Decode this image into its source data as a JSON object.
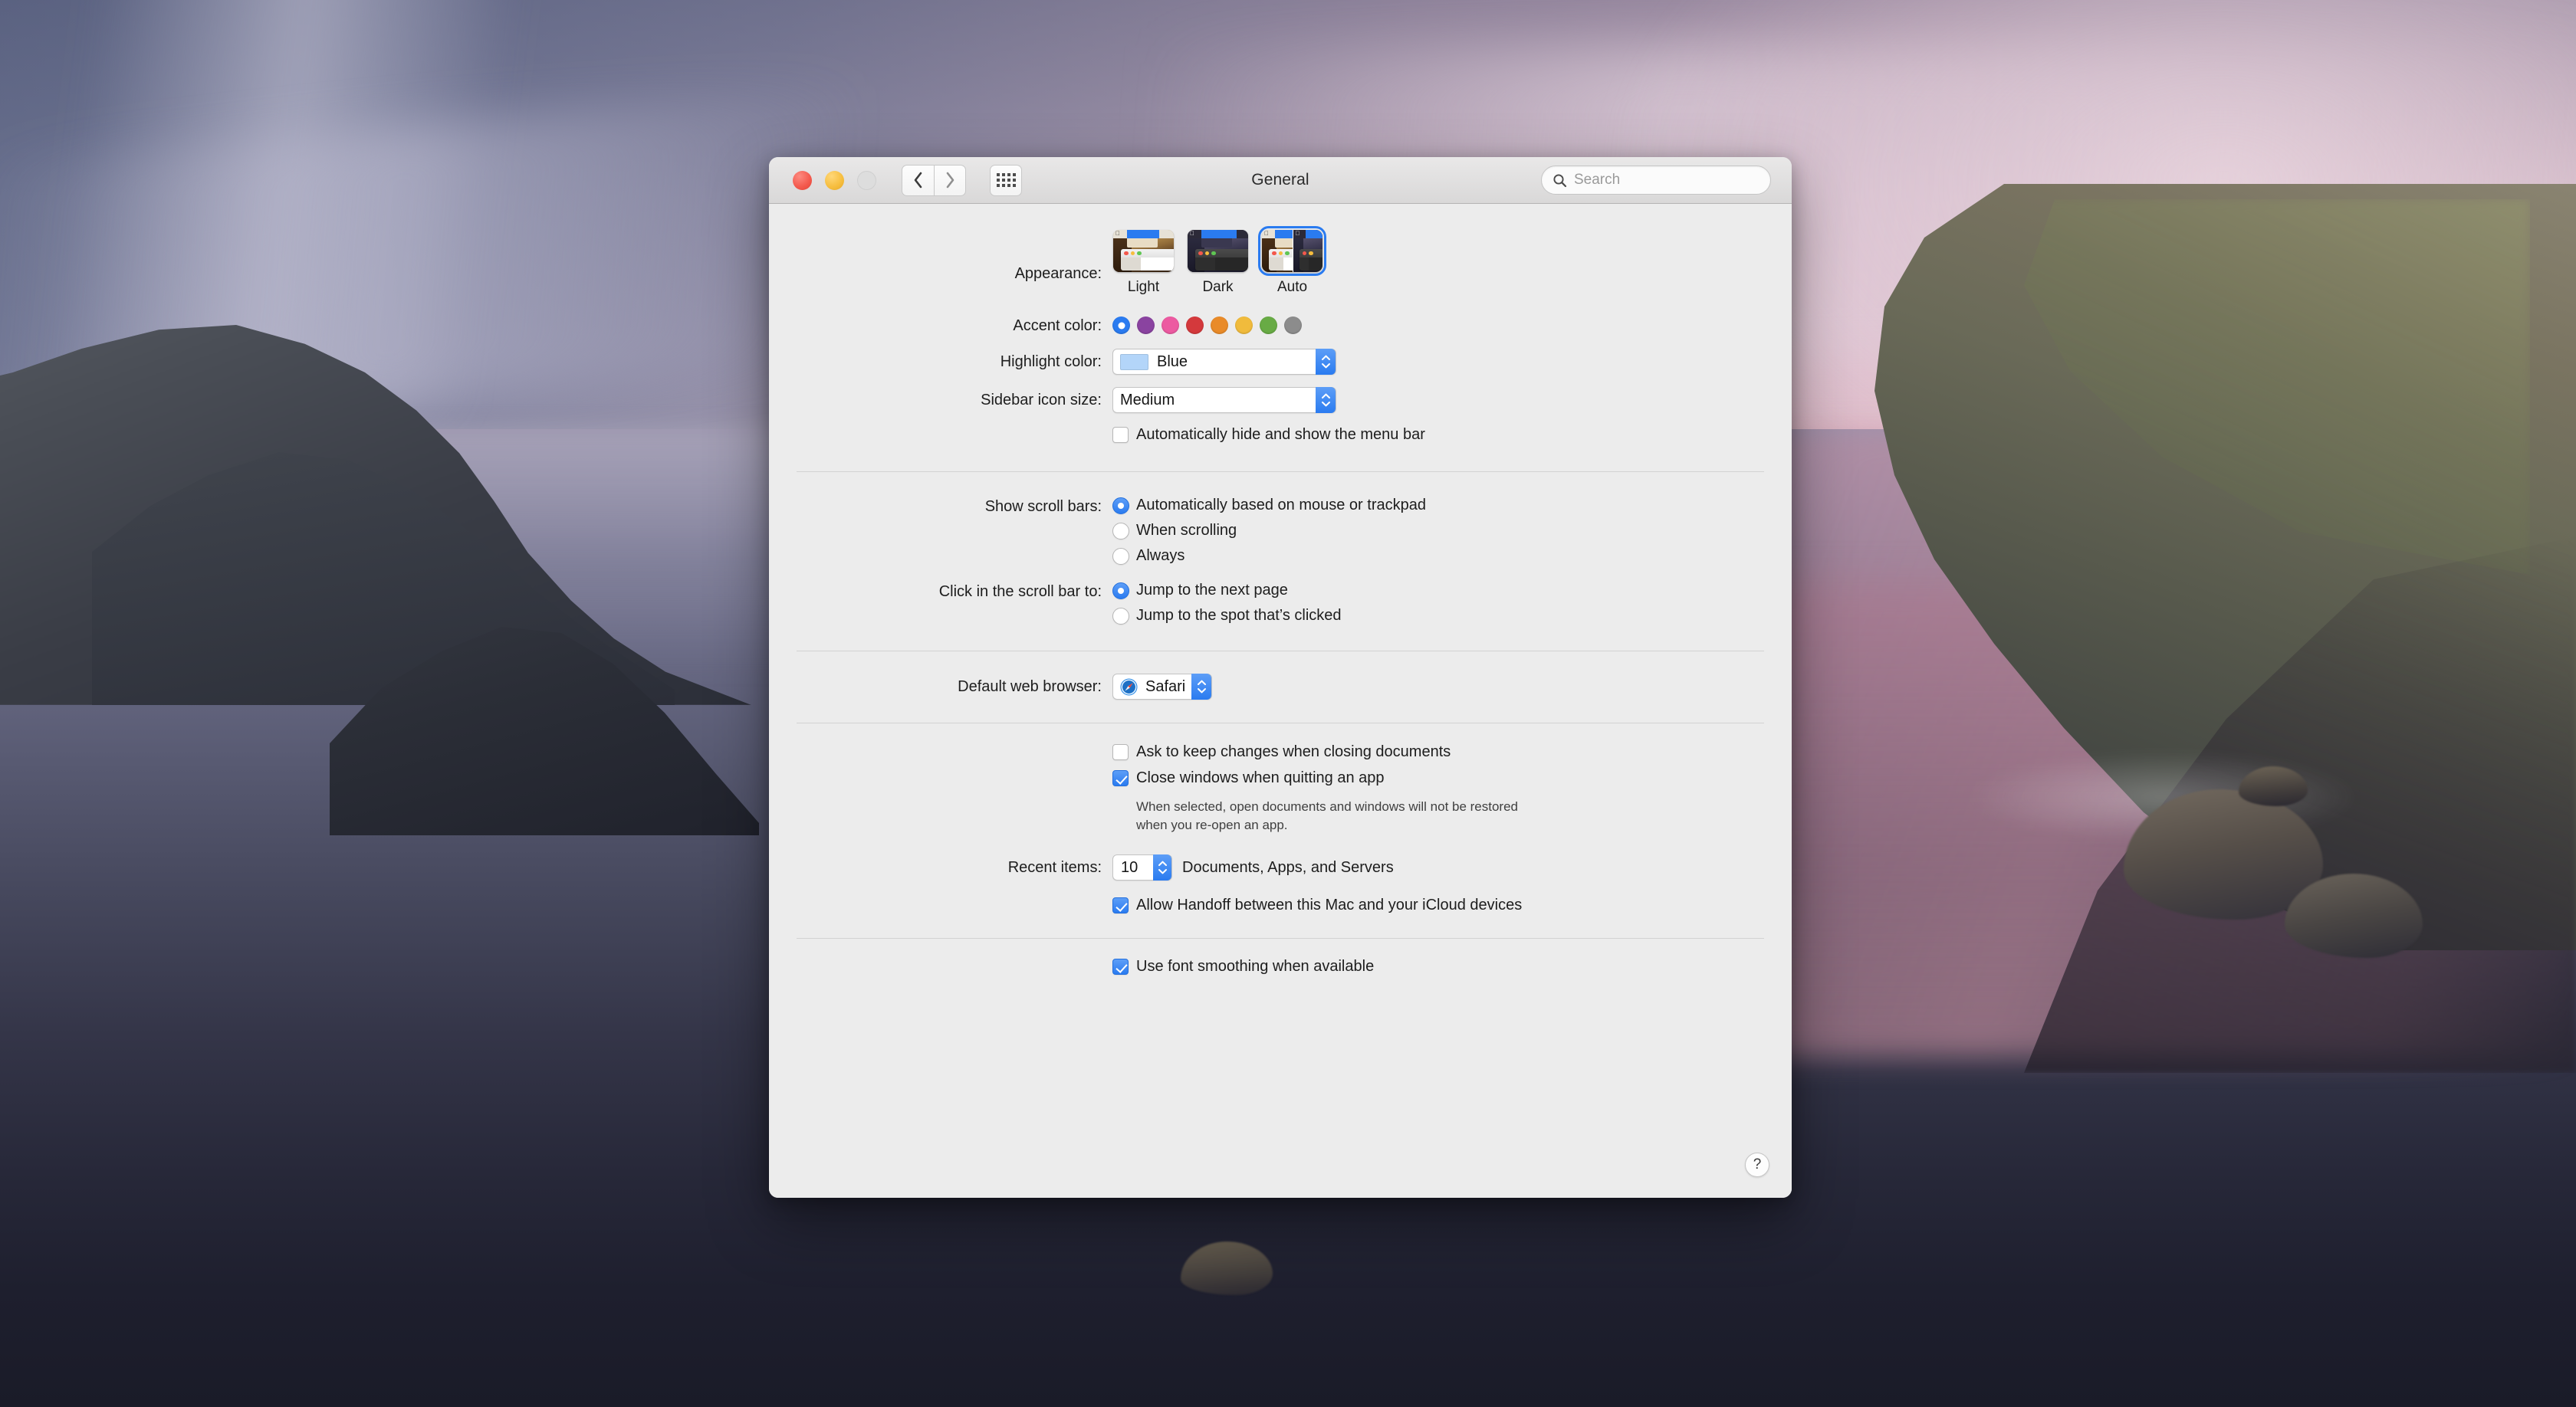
{
  "window": {
    "title": "General",
    "traffic_lights": [
      "close",
      "minimize",
      "zoom"
    ],
    "nav": {
      "back": "back-chevron",
      "forward": "forward-chevron",
      "grid": "show-all-grid"
    },
    "search": {
      "placeholder": "Search",
      "icon": "search-icon"
    },
    "help_label": "?"
  },
  "appearance": {
    "label": "Appearance:",
    "options": [
      {
        "name": "Light",
        "selected": false
      },
      {
        "name": "Dark",
        "selected": false
      },
      {
        "name": "Auto",
        "selected": true
      }
    ]
  },
  "accent_color": {
    "label": "Accent color:",
    "selected_index": 0,
    "swatches": [
      {
        "name": "Blue",
        "hex": "#2a7bf0"
      },
      {
        "name": "Purple",
        "hex": "#8a43a0"
      },
      {
        "name": "Pink",
        "hex": "#ec5aa1"
      },
      {
        "name": "Red",
        "hex": "#d4393c"
      },
      {
        "name": "Orange",
        "hex": "#e98b29"
      },
      {
        "name": "Yellow",
        "hex": "#f0bb3c"
      },
      {
        "name": "Green",
        "hex": "#68ab45"
      },
      {
        "name": "Graphite",
        "hex": "#8c8c8c"
      }
    ]
  },
  "highlight_color": {
    "label": "Highlight color:",
    "value": "Blue",
    "swatch_hex": "#b3d5f9"
  },
  "sidebar_icon_size": {
    "label": "Sidebar icon size:",
    "value": "Medium"
  },
  "auto_hide_menu_bar": {
    "label": "Automatically hide and show the menu bar",
    "checked": false
  },
  "show_scroll_bars": {
    "label": "Show scroll bars:",
    "options": [
      {
        "label": "Automatically based on mouse or trackpad",
        "selected": true
      },
      {
        "label": "When scrolling",
        "selected": false
      },
      {
        "label": "Always",
        "selected": false
      }
    ]
  },
  "click_scroll_bar": {
    "label": "Click in the scroll bar to:",
    "options": [
      {
        "label": "Jump to the next page",
        "selected": true
      },
      {
        "label": "Jump to the spot that’s clicked",
        "selected": false
      }
    ]
  },
  "default_browser": {
    "label": "Default web browser:",
    "value": "Safari",
    "icon": "safari-icon"
  },
  "document_options": {
    "ask_keep_changes": {
      "label": "Ask to keep changes when closing documents",
      "checked": false
    },
    "close_windows": {
      "label": "Close windows when quitting an app",
      "checked": true
    },
    "note_line1": "When selected, open documents and windows will not be restored",
    "note_line2": "when you re-open an app."
  },
  "recent_items": {
    "label": "Recent items:",
    "value": "10",
    "suffix": "Documents, Apps, and Servers"
  },
  "handoff": {
    "label": "Allow Handoff between this Mac and your iCloud devices",
    "checked": true
  },
  "font_smoothing": {
    "label": "Use font smoothing when available",
    "checked": true
  },
  "theme": {
    "accent_hex": "#2a7bf0",
    "window_bg": "#ececec",
    "titlebar_bg": "#e4e3e3"
  }
}
